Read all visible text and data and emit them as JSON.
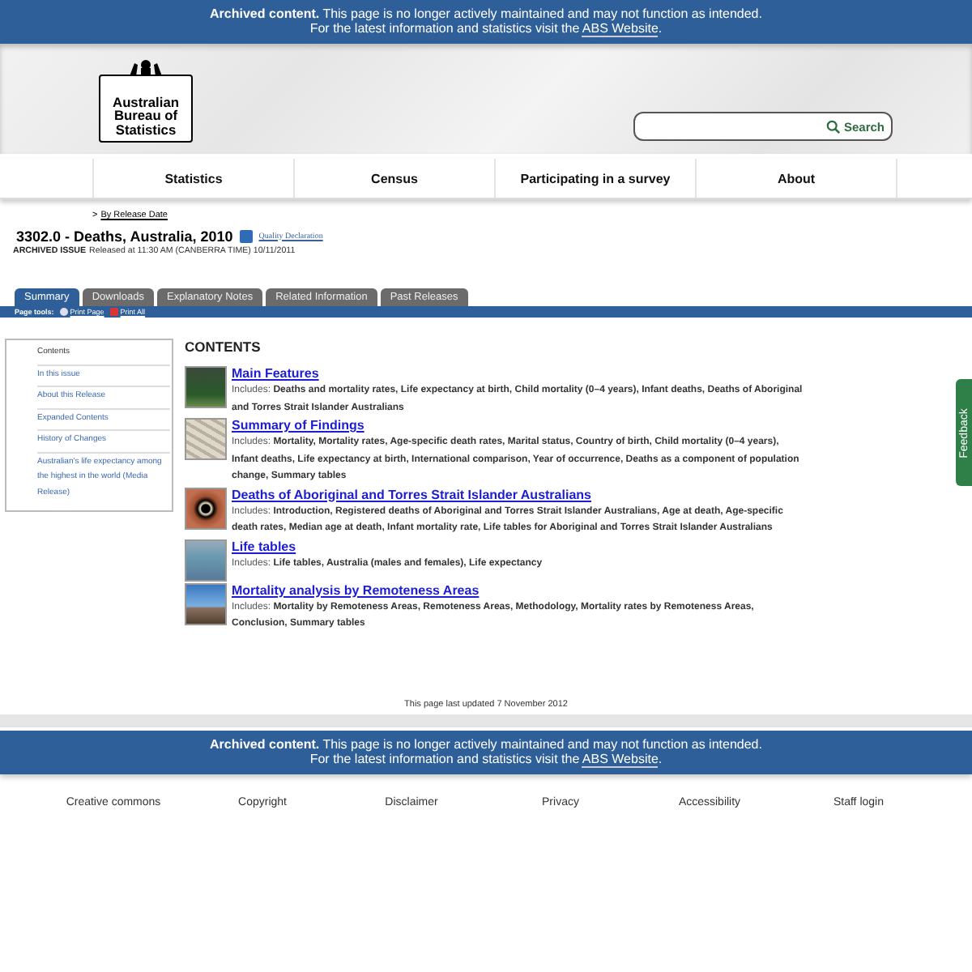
{
  "top_notice": {
    "message": "**Archived content.** This page is no longer actively maintained and may not function as intended.",
    "line2": "For the latest information and statistics visit the",
    "link": "ABS Website",
    "tail": "."
  },
  "header": {
    "logo_lines": [
      "Australian",
      "Bureau of",
      "Statistics"
    ],
    "search": {
      "button": "Search"
    }
  },
  "nav": [
    "Statistics",
    "Census",
    "Participating in a survey",
    "About"
  ],
  "breadcrumb": {
    "separator": ">",
    "link": "By Release Date"
  },
  "title": "3302.0 - Deaths, Australia, 2010",
  "quality_link": "Quality Declaration",
  "issue": {
    "label": "ARCHIVED ISSUE",
    "text": "Released at 11:30 AM (CANBERRA TIME) 10/11/2011"
  },
  "tabs": [
    {
      "label": "Summary",
      "selected": true
    },
    {
      "label": "Downloads",
      "selected": false
    },
    {
      "label": "Explanatory Notes",
      "selected": false
    },
    {
      "label": "Related Information",
      "selected": false
    },
    {
      "label": "Past Releases",
      "selected": false
    }
  ],
  "page_tools": {
    "label": "Page tools:",
    "links": [
      "Print Page",
      "Print All"
    ]
  },
  "sidebar": [
    {
      "kind": "heading",
      "label": "Contents"
    },
    {
      "kind": "link",
      "label": "In this issue"
    },
    {
      "kind": "link",
      "label": "About this Release"
    },
    {
      "kind": "link",
      "label": "Expanded Contents"
    },
    {
      "kind": "link",
      "label": "History of Changes"
    },
    {
      "kind": "link",
      "label": "Australian's life expectancy among the highest in the world (Media Release)"
    }
  ],
  "contents": {
    "heading": "CONTENTS",
    "items": [
      {
        "title": "Main Features",
        "label": "Includes:",
        "text": "Deaths and mortality rates, Life expectancy at birth, Child mortality (0–4 years), Infant deaths, Deaths of Aboriginal and Torres Strait Islander Australians"
      },
      {
        "title": "Summary of Findings",
        "label": "Includes:",
        "text": "Mortality, Mortality rates, Age-specific death rates, Marital status, Country of birth, Child mortality (0–4 years), Infant deaths, Life expectancy at birth, International comparison, Year of occurrence, Deaths as a component of population change, Summary tables"
      },
      {
        "title": "Deaths of Aboriginal and Torres Strait Islander Australians",
        "label": "Includes:",
        "text": "Introduction, Registered deaths of Aboriginal and Torres Strait Islander Australians, Age at death, Age-specific death rates, Median age at death, Infant mortality rate, Life tables for Aboriginal and Torres Strait Islander Australians"
      },
      {
        "title": "Life tables",
        "label": "Includes:",
        "text": "Life tables, Australia (males and females), Life expectancy"
      },
      {
        "title": "Mortality analysis by Remoteness Areas",
        "label": "Includes:",
        "text": "Mortality by Remoteness Areas, Remoteness Areas, Methodology, Mortality rates by Remoteness Areas, Conclusion, Summary tables"
      }
    ]
  },
  "last_updated": "This page last updated 7 November 2012",
  "bottom_notice": {
    "message": "**Archived content.** This page is no longer actively maintained and may not function as intended.",
    "line2": "For the latest information and statistics visit the",
    "link": "ABS Website",
    "tail": "."
  },
  "footer_links": [
    "Creative commons",
    "Copyright",
    "Disclaimer",
    "Privacy",
    "Accessibility",
    "Staff login"
  ],
  "feedback": "Feedback"
}
